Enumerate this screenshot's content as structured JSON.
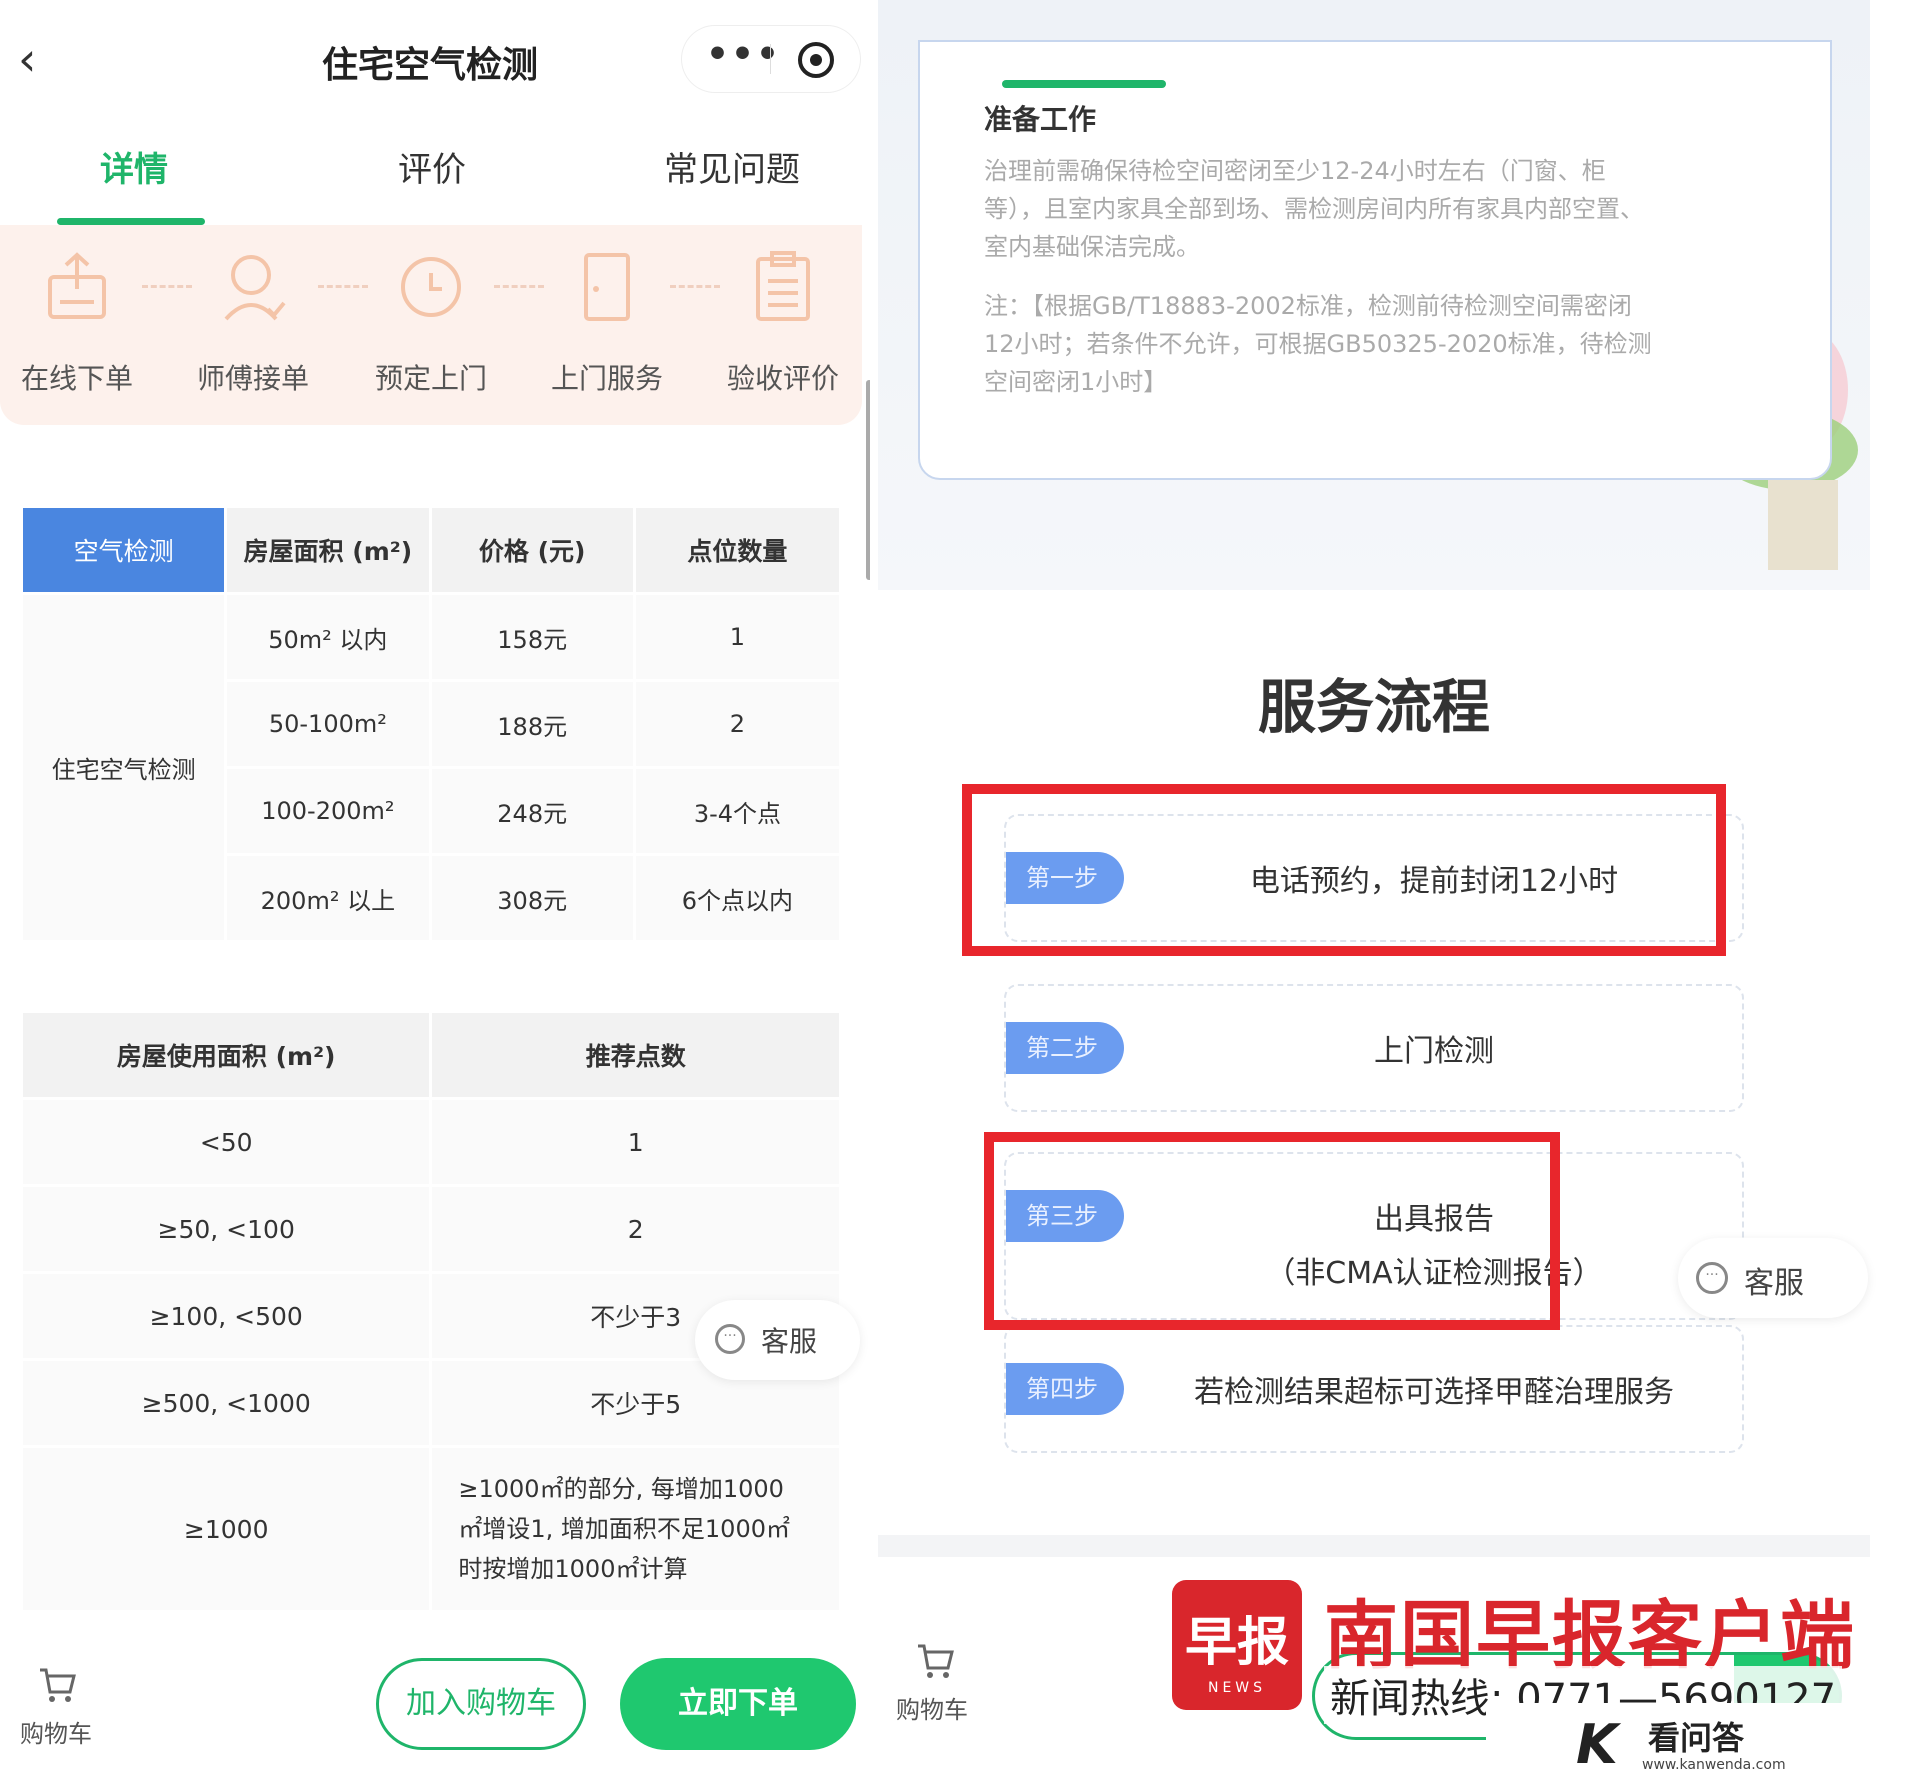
{
  "left": {
    "nav": {
      "back_icon": "‹",
      "title": "住宅空气检测",
      "more_icon": "•••"
    },
    "tabs": [
      {
        "label": "详情",
        "active": true
      },
      {
        "label": "评价",
        "active": false
      },
      {
        "label": "常见问题",
        "active": false
      }
    ],
    "process": [
      {
        "label": "在线下单",
        "icon": "order-upload-icon"
      },
      {
        "label": "师傅接单",
        "icon": "worker-icon"
      },
      {
        "label": "预定上门",
        "icon": "clock-icon"
      },
      {
        "label": "上门服务",
        "icon": "door-icon"
      },
      {
        "label": "验收评价",
        "icon": "clipboard-icon"
      }
    ],
    "price_table": {
      "headers": [
        "空气检测",
        "房屋面积 (m²)",
        "价格 (元)",
        "点位数量"
      ],
      "category": "住宅空气检测",
      "rows": [
        [
          "50m² 以内",
          "158元",
          "1"
        ],
        [
          "50-100m²",
          "188元",
          "2"
        ],
        [
          "100-200m²",
          "248元",
          "3-4个点"
        ],
        [
          "200m² 以上",
          "308元",
          "6个点以内"
        ]
      ]
    },
    "points_table": {
      "headers": [
        "房屋使用面积 (m²)",
        "推荐点数"
      ],
      "rows": [
        [
          "<50",
          "1"
        ],
        [
          "≥50, <100",
          "2"
        ],
        [
          "≥100, <500",
          "不少于3"
        ],
        [
          "≥500, <1000",
          "不少于5"
        ]
      ],
      "last_row": {
        "area": "≥1000",
        "lines": [
          "≥1000㎡的部分, 每增加1000",
          "㎡增设1, 增加面积不足1000㎡",
          "时按增加1000㎡计算"
        ]
      }
    },
    "customer_service": "客服",
    "bottom": {
      "cart_label": "购物车",
      "add_cart": "加入购物车",
      "buy_now": "立即下单"
    }
  },
  "right": {
    "prep": {
      "title": "准备工作",
      "lines": [
        "治理前需确保待检空间密闭至少12-24小时左右（门窗、柜",
        "等），且室内家具全部到场、需检测房间内所有家具内部空置、",
        "室内基础保洁完成。"
      ],
      "note_lines": [
        "注：【根据GB/T18883-2002标准，检测前待检测空间需密闭",
        "12小时；若条件不允许，可根据GB50325-2020标准，待检测",
        "空间密闭1小时】"
      ]
    },
    "flow_title": "服务流程",
    "flow_steps": [
      {
        "step": "第一步",
        "text": "电话预约，提前封闭12小时",
        "sub": ""
      },
      {
        "step": "第二步",
        "text": "上门检测",
        "sub": ""
      },
      {
        "step": "第三步",
        "text": "出具报告",
        "sub": "（非CMA认证检测报告）"
      },
      {
        "step": "第四步",
        "text": "若检测结果超标可选择甲醛治理服务",
        "sub": ""
      }
    ],
    "customer_service": "客服",
    "cart_label": "购物车",
    "highlight_color": "#e8262c"
  },
  "watermark": {
    "logo_big": "早报",
    "logo_small": "NEWS",
    "name": "南国早报客户端",
    "hotline": "新闻热线: 0771—5690127",
    "site_name": "看问答",
    "site_url": "www.kanwenda.com"
  },
  "colors": {
    "accent_green": "#1fb56a",
    "table_blue": "#4a86e0",
    "step_blue": "#6b9cf0",
    "red": "#d9262c"
  }
}
